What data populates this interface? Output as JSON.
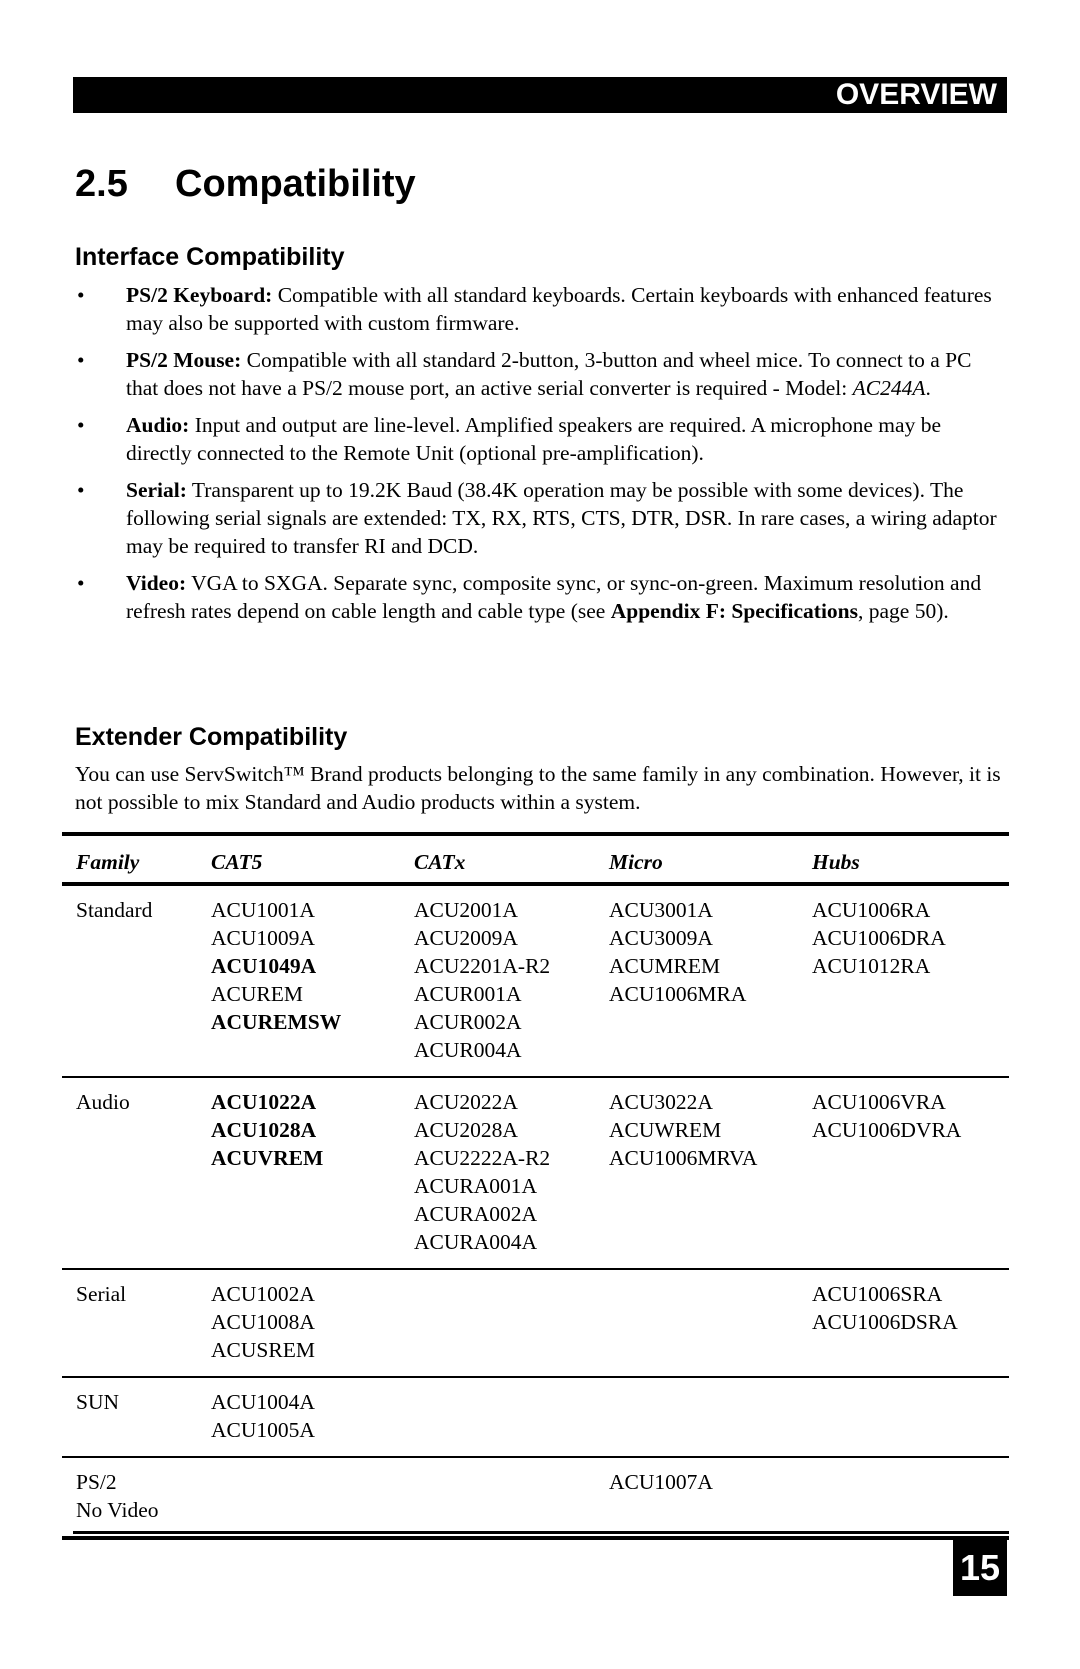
{
  "header": {
    "section_label": "OVERVIEW"
  },
  "section": {
    "number": "2.5",
    "title": "Compatibility"
  },
  "interface": {
    "heading": "Interface Compatibility",
    "bullet_glyph": "•",
    "items": [
      {
        "label": "PS/2 Keyboard:",
        "text": " Compatible with all standard keyboards. Certain keyboards with enhanced features may also be supported with custom firmware."
      },
      {
        "label": "PS/2 Mouse:",
        "text": " Compatible with all standard 2-button, 3-button and wheel mice. To connect to a PC that does not have a PS/2 mouse port, an active serial converter is required - Model: ",
        "italic": "AC244A",
        "after": "."
      },
      {
        "label": "Audio:",
        "text": " Input and output are line-level. Amplified speakers are required. A microphone may be directly connected to the Remote Unit (optional pre-amplification)."
      },
      {
        "label": "Serial:",
        "text": " Transparent up to 19.2K Baud (38.4K operation may be possible with some devices). The following serial signals are extended: TX, RX, RTS, CTS, DTR, DSR. In rare cases, a wiring adaptor may be required to transfer RI and DCD."
      },
      {
        "label": "Video:",
        "text": " VGA to SXGA. Separate sync, composite sync, or sync-on-green. Maximum resolution and refresh rates depend on cable length and cable type (see ",
        "bold_ref": "Appendix F: Specifications",
        "after": ", page 50)."
      }
    ]
  },
  "extender": {
    "heading": "Extender Compatibility",
    "intro": "You can use ServSwitch™ Brand products belonging to the same family in any combination. However, it is not possible to mix Standard and Audio products within a system.",
    "table": {
      "headers": [
        "Family",
        "CAT5",
        "CATx",
        "Micro",
        "Hubs"
      ],
      "groups": [
        {
          "family": [
            "Standard"
          ],
          "cat5": [
            {
              "text": "ACU1001A",
              "bold": false
            },
            {
              "text": "ACU1009A",
              "bold": false
            },
            {
              "text": "ACU1049A",
              "bold": true
            },
            {
              "text": "ACUREM",
              "bold": false
            },
            {
              "text": "ACUREMSW",
              "bold": true
            }
          ],
          "catx": [
            "ACU2001A",
            "ACU2009A",
            "ACU2201A-R2",
            "ACUR001A",
            "ACUR002A",
            "ACUR004A"
          ],
          "micro": [
            "ACU3001A",
            "ACU3009A",
            "ACUMREM",
            "ACU1006MRA"
          ],
          "hubs": [
            "ACU1006RA",
            "ACU1006DRA",
            "ACU1012RA"
          ]
        },
        {
          "family": [
            "Audio"
          ],
          "cat5": [
            {
              "text": "ACU1022A",
              "bold": true
            },
            {
              "text": "ACU1028A",
              "bold": true
            },
            {
              "text": "ACUVREM",
              "bold": true
            }
          ],
          "catx": [
            "ACU2022A",
            "ACU2028A",
            "ACU2222A-R2",
            "ACURA001A",
            "ACURA002A",
            "ACURA004A"
          ],
          "micro": [
            "ACU3022A",
            "ACUWREM",
            "ACU1006MRVA"
          ],
          "hubs": [
            "ACU1006VRA",
            "ACU1006DVRA"
          ]
        },
        {
          "family": [
            "Serial"
          ],
          "cat5": [
            {
              "text": "ACU1002A",
              "bold": false
            },
            {
              "text": "ACU1008A",
              "bold": false
            },
            {
              "text": "ACUSREM",
              "bold": false
            }
          ],
          "catx": [],
          "micro": [],
          "hubs": [
            "ACU1006SRA",
            "ACU1006DSRA"
          ]
        },
        {
          "family": [
            "SUN"
          ],
          "cat5": [
            {
              "text": "ACU1004A",
              "bold": false
            },
            {
              "text": "ACU1005A",
              "bold": false
            }
          ],
          "catx": [],
          "micro": [],
          "hubs": []
        },
        {
          "family": [
            "PS/2",
            "No Video"
          ],
          "cat5": [],
          "catx": [],
          "micro": [
            "ACU1007A"
          ],
          "hubs": []
        }
      ]
    }
  },
  "footer": {
    "page_number": "15"
  }
}
